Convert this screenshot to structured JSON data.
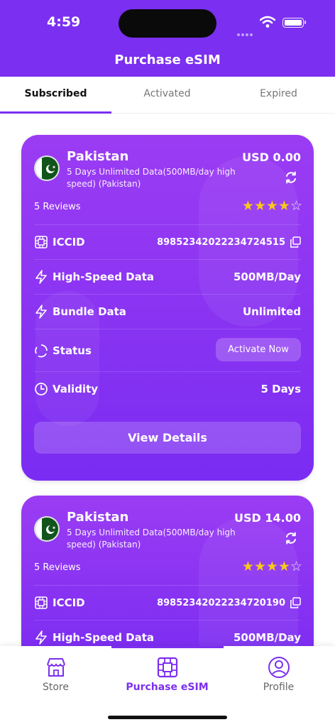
{
  "status_bar": {
    "time": "4:59"
  },
  "header": {
    "title": "Purchase eSIM"
  },
  "tabs": [
    {
      "label": "Subscribed",
      "active": true
    },
    {
      "label": "Activated",
      "active": false
    },
    {
      "label": "Expired",
      "active": false
    }
  ],
  "cards": [
    {
      "country": "Pakistan",
      "plan": "5 Days Unlimited Data(500MB/day high speed) (Pakistan)",
      "price": "USD 0.00",
      "reviews": "5 Reviews",
      "rating": 4,
      "rating_max": 5,
      "iccid_label": "ICCID",
      "iccid": "89852342022234724515",
      "high_speed_label": "High-Speed Data",
      "high_speed_value": "500MB/Day",
      "bundle_label": "Bundle Data",
      "bundle_value": "Unlimited",
      "status_label": "Status",
      "status_action": "Activate Now",
      "validity_label": "Validity",
      "validity_value": "5 Days",
      "details_button": "View Details"
    },
    {
      "country": "Pakistan",
      "plan": "5 Days Unlimited Data(500MB/day high speed) (Pakistan)",
      "price": "USD 14.00",
      "reviews": "5 Reviews",
      "rating": 4,
      "rating_max": 5,
      "iccid_label": "ICCID",
      "iccid": "89852342022234720190",
      "high_speed_label": "High-Speed Data",
      "high_speed_value": "500MB/Day"
    }
  ],
  "bottom_nav": [
    {
      "label": "Store",
      "icon": "store-icon",
      "active": false
    },
    {
      "label": "Purchase eSIM",
      "icon": "sim-card-icon",
      "active": true
    },
    {
      "label": "Profile",
      "icon": "profile-icon",
      "active": false
    }
  ],
  "colors": {
    "primary": "#7b2ff0",
    "star": "#f8c81a",
    "flag_green": "#11541c"
  }
}
